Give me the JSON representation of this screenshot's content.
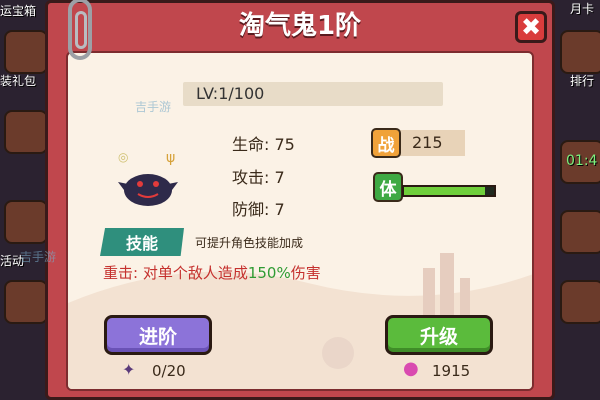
{
  "dialog": {
    "title": "淘气鬼1阶",
    "close_symbol": "✖"
  },
  "side": {
    "left_labels": [
      "运宝箱",
      "装礼包",
      "活动"
    ],
    "right_labels": [
      "月卡",
      "排行"
    ],
    "timer": "01:4"
  },
  "monster": {
    "level_text": "LV:1/100",
    "stats": {
      "hp": "生命: 75",
      "attack": "攻击: 7",
      "defense": "防御: 7"
    },
    "power_badge": "战",
    "power_value": "215",
    "stamina_badge": "体",
    "stamina_fraction": 0.9
  },
  "skill": {
    "tag": "技能",
    "desc": "可提升角色技能加成",
    "effect_prefix": "重击: 对单个敌人造成",
    "effect_highlight": "150%",
    "effect_suffix": "伤害"
  },
  "actions": {
    "advance_label": "进阶",
    "upgrade_label": "升级"
  },
  "resources": {
    "fragments": "0/20",
    "essence": "1915"
  },
  "watermark": "吉手游",
  "colors": {
    "panel": "#c0474d",
    "advance": "#8c73d9",
    "upgrade": "#5bbb3c",
    "skill_tag": "#2f8f7d"
  }
}
